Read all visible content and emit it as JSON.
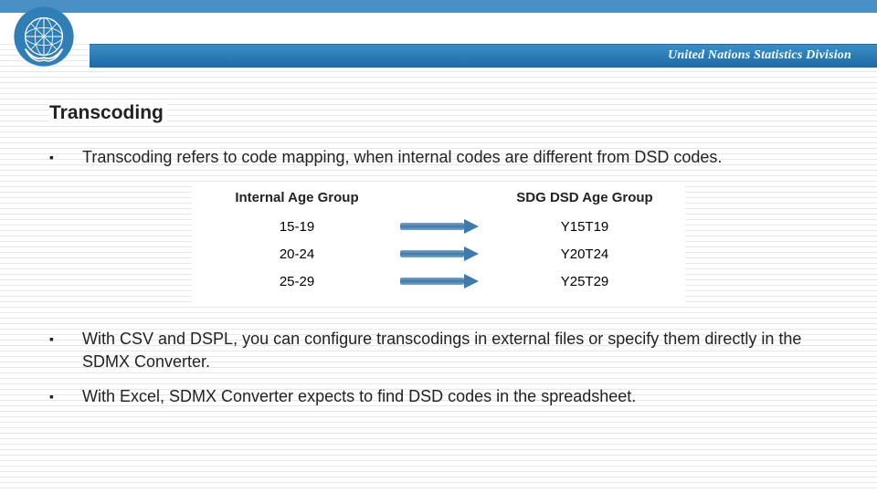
{
  "header": {
    "org": "United Nations Statistics Division"
  },
  "title": "Transcoding",
  "bullets": {
    "b1": "Transcoding refers to code mapping, when internal codes are different from DSD codes.",
    "b2": "With CSV and DSPL, you can configure transcodings in external files or specify them directly in the SDMX Converter.",
    "b3": "With Excel, SDMX Converter expects to find DSD codes in the spreadsheet."
  },
  "diagram": {
    "head_left": "Internal Age Group",
    "head_right": "SDG DSD Age Group",
    "rows": [
      {
        "left": "15-19",
        "right": "Y15T19"
      },
      {
        "left": "20-24",
        "right": "Y20T24"
      },
      {
        "left": "25-29",
        "right": "Y25T29"
      }
    ]
  }
}
